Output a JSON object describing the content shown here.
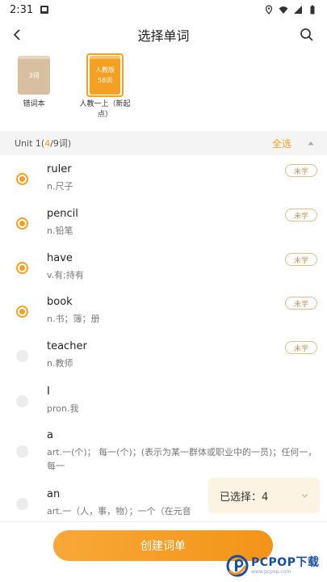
{
  "status_bar": {
    "time": "2:31"
  },
  "header": {
    "title": "选择单词"
  },
  "books": [
    {
      "cover_text": "3词",
      "label": "错词本",
      "color": "#d8bfa0",
      "selected": false
    },
    {
      "cover_title": "人教版",
      "cover_text": "58词",
      "label_line1": "人教一上（新起",
      "label_line2": "点）",
      "color": "#f5a021",
      "selected": true
    }
  ],
  "unit": {
    "name": "Unit 1",
    "paren_open": " (",
    "count": "4",
    "total": "/9词)",
    "select_all": "全选"
  },
  "words": [
    {
      "word": "ruler",
      "meaning": "n.尺子",
      "badge": "未学",
      "checked": true
    },
    {
      "word": "pencil",
      "meaning": "n.铅笔",
      "badge": "未学",
      "checked": true
    },
    {
      "word": "have",
      "meaning": "v.有;持有",
      "badge": "未学",
      "checked": true
    },
    {
      "word": "book",
      "meaning": "n.书；簿；册",
      "badge": "未学",
      "checked": true
    },
    {
      "word": "teacher",
      "meaning": "n.教师",
      "badge": "未学",
      "checked": false
    },
    {
      "word": "I",
      "meaning": "pron.我",
      "badge": "",
      "checked": false
    },
    {
      "word": "a",
      "meaning": "art.一(个)； 每一(个)；(表示为某一群体或职业中的一员)；任何一，每一",
      "badge": "",
      "checked": false
    },
    {
      "word": "an",
      "meaning": "art.一（人，事，物）；一个（在元音",
      "badge": "",
      "checked": false
    }
  ],
  "selection": {
    "label": "已选择：4"
  },
  "actions": {
    "create_label": "创建词单"
  },
  "watermark": {
    "brand": "PCPOP下载",
    "sub": "www.pcpop.com"
  },
  "colors": {
    "accent": "#f5a021",
    "badge_border": "#d8c08e",
    "panel_bg": "#fdf3e3"
  }
}
